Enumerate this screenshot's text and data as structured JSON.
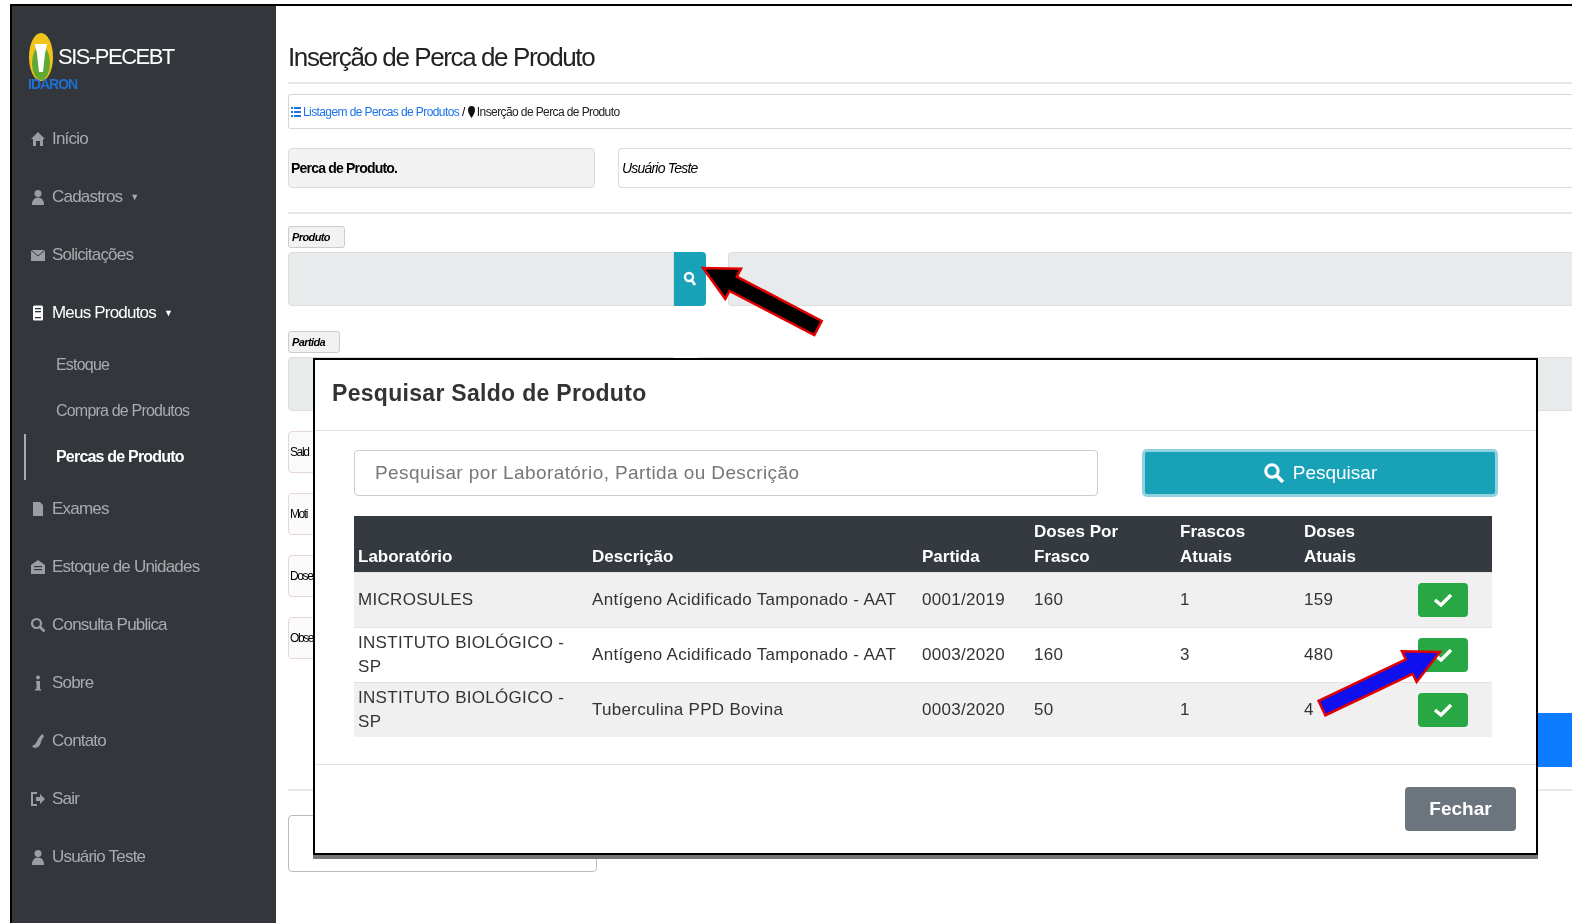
{
  "sidebar": {
    "brand": "SIS-PECEBT",
    "org": "IDARON",
    "items": [
      {
        "label": "Início",
        "selected": false
      },
      {
        "label": "Cadastros",
        "caret": "▼",
        "selected": false
      },
      {
        "label": "Solicitações",
        "selected": false
      },
      {
        "label": "Meus Produtos",
        "caret": "▼",
        "selected": false,
        "expanded": true,
        "children": [
          {
            "label": "Estoque",
            "selected": false
          },
          {
            "label": "Compra de Produtos",
            "selected": false
          },
          {
            "label": "Percas de Produto",
            "selected": true
          }
        ]
      },
      {
        "label": "Exames",
        "selected": false
      },
      {
        "label": "Estoque de Unidades",
        "selected": false
      },
      {
        "label": "Consulta Publica",
        "selected": false
      },
      {
        "label": "Sobre",
        "selected": false
      },
      {
        "label": "Contato",
        "selected": false
      },
      {
        "label": "Sair",
        "selected": false
      },
      {
        "label": "Usuário Teste",
        "selected": false
      }
    ]
  },
  "page": {
    "title": "Inserção de Perca de Produto",
    "breadcrumb": [
      {
        "label": "Listagem de Percas de Produtos",
        "link": true
      },
      {
        "label": "Inserção de Perca de Produto",
        "link": false
      }
    ],
    "breadcrumb_separator": "/",
    "header_fields": [
      "Perca de Produto.",
      "Usuário Teste"
    ],
    "product_label": "Produto",
    "batch_label": "Partida",
    "side_labels": [
      "Sald",
      "Moti",
      "Dose",
      "Obse"
    ]
  },
  "modal": {
    "title": "Pesquisar Saldo de Produto",
    "search": {
      "placeholder": "Pesquisar por Laboratório, Partida ou Descrição"
    },
    "search_button": "Pesquisar",
    "table": {
      "columns": [
        "Laboratório",
        "Descrição",
        "Partida",
        "Doses Por Frasco",
        "Frascos Atuais",
        "Doses Atuais"
      ],
      "rows": [
        {
          "cells": [
            "MICROSULES",
            "Antígeno Acidificado Tamponado - AAT",
            "0001/2019",
            "160",
            "1",
            "159"
          ]
        },
        {
          "cells": [
            "INSTITUTO BIOLÓGICO - SP",
            "Antígeno Acidificado Tamponado - AAT",
            "0003/2020",
            "160",
            "3",
            "480"
          ]
        },
        {
          "cells": [
            "INSTITUTO BIOLÓGICO - SP",
            "Tuberculina PPD Bovina",
            "0003/2020",
            "50",
            "1",
            "4"
          ]
        }
      ]
    },
    "close_button": "Fechar"
  }
}
